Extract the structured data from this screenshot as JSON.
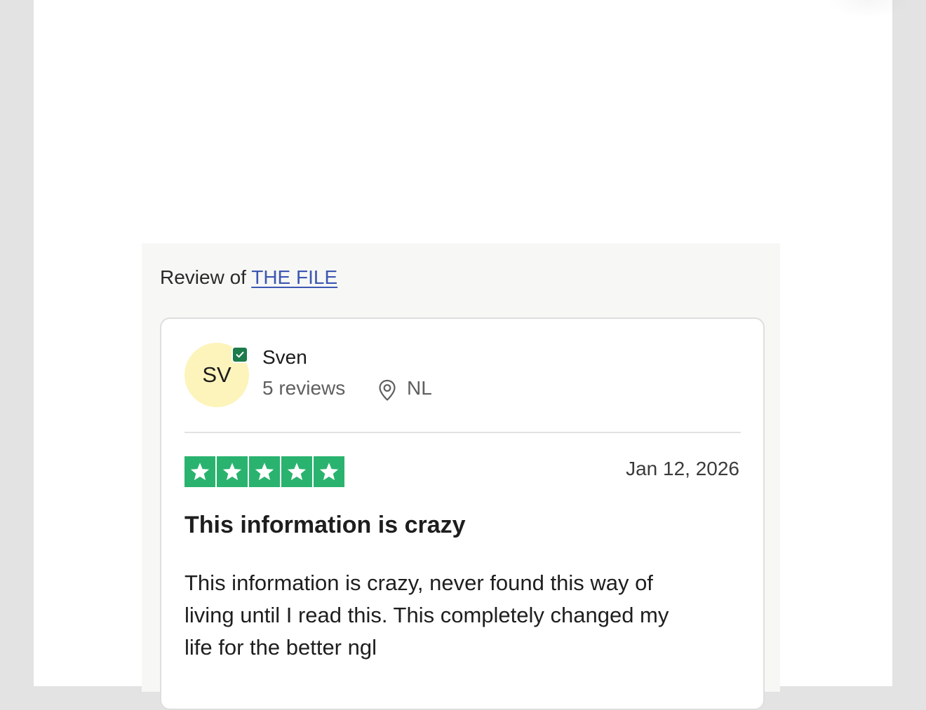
{
  "review_of": {
    "prefix": "Review of",
    "company": "THE FILE"
  },
  "reviewer": {
    "initials": "SV",
    "name": "Sven",
    "review_count": "5 reviews",
    "country": "NL",
    "verified": true
  },
  "review": {
    "rating": 5,
    "date": "Jan 12, 2026",
    "title": "This information is crazy",
    "body": "This information is crazy, never found this way of living until I read this. This completely changed my life for the better ngl"
  },
  "colors": {
    "star_green": "#2ab36e",
    "badge_green": "#1b7b4a",
    "avatar_bg": "#fcf4bb",
    "link_blue": "#3c57b2"
  },
  "icons": {
    "verified": "check-badge-icon",
    "location": "location-pin-icon",
    "star": "star-icon"
  }
}
